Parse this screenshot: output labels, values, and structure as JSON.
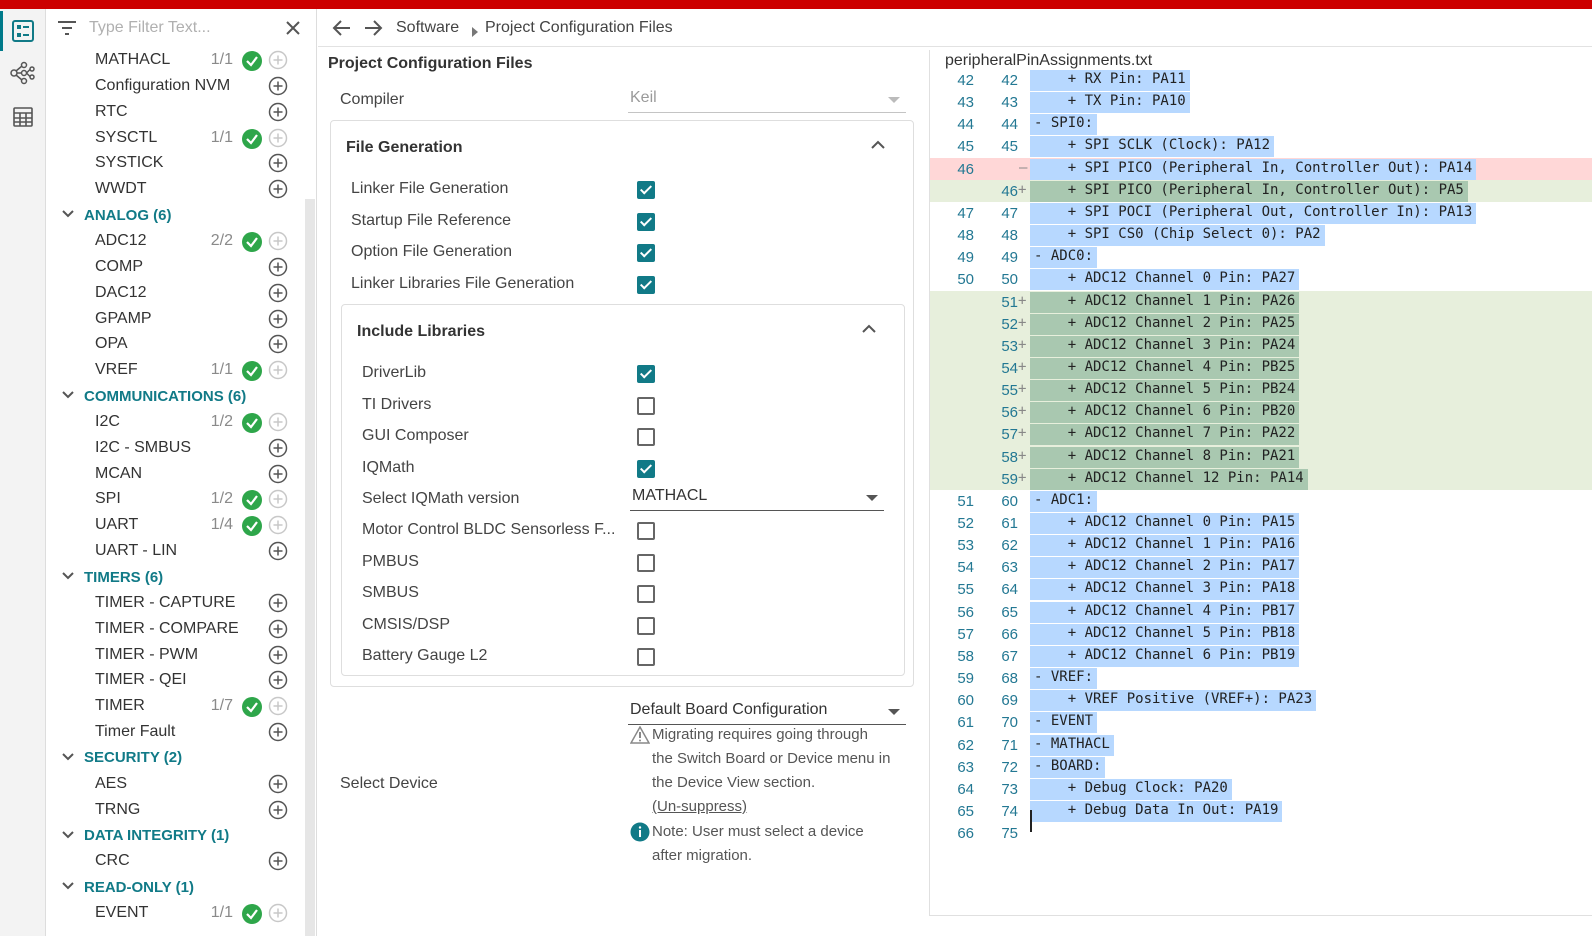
{
  "colors": {
    "accent": "#117a87",
    "topbar": "#cc0000",
    "selection": "#b7d8ff",
    "ok": "#2ea64a"
  },
  "activity": [
    {
      "icon": "configuration-list-icon"
    },
    {
      "icon": "hierarchy-diagram-icon"
    },
    {
      "icon": "calculator-icon"
    }
  ],
  "filter": {
    "placeholder": "Type Filter Text..."
  },
  "tree": [
    {
      "kind": "item",
      "label": "MATHACL",
      "count": "1/1",
      "ok": true
    },
    {
      "kind": "item",
      "label": "Configuration NVM",
      "count": "",
      "ok": false
    },
    {
      "kind": "item",
      "label": "RTC",
      "count": "",
      "ok": false
    },
    {
      "kind": "item",
      "label": "SYSCTL",
      "count": "1/1",
      "ok": true
    },
    {
      "kind": "item",
      "label": "SYSTICK",
      "count": "",
      "ok": false
    },
    {
      "kind": "item",
      "label": "WWDT",
      "count": "",
      "ok": false
    },
    {
      "kind": "cat",
      "label": "ANALOG (6)"
    },
    {
      "kind": "item",
      "label": "ADC12",
      "count": "2/2",
      "ok": true
    },
    {
      "kind": "item",
      "label": "COMP",
      "count": "",
      "ok": false
    },
    {
      "kind": "item",
      "label": "DAC12",
      "count": "",
      "ok": false
    },
    {
      "kind": "item",
      "label": "GPAMP",
      "count": "",
      "ok": false
    },
    {
      "kind": "item",
      "label": "OPA",
      "count": "",
      "ok": false
    },
    {
      "kind": "item",
      "label": "VREF",
      "count": "1/1",
      "ok": true
    },
    {
      "kind": "cat",
      "label": "COMMUNICATIONS (6)"
    },
    {
      "kind": "item",
      "label": "I2C",
      "count": "1/2",
      "ok": true
    },
    {
      "kind": "item",
      "label": "I2C - SMBUS",
      "count": "",
      "ok": false
    },
    {
      "kind": "item",
      "label": "MCAN",
      "count": "",
      "ok": false
    },
    {
      "kind": "item",
      "label": "SPI",
      "count": "1/2",
      "ok": true
    },
    {
      "kind": "item",
      "label": "UART",
      "count": "1/4",
      "ok": true
    },
    {
      "kind": "item",
      "label": "UART - LIN",
      "count": "",
      "ok": false
    },
    {
      "kind": "cat",
      "label": "TIMERS (6)"
    },
    {
      "kind": "item",
      "label": "TIMER - CAPTURE",
      "count": "",
      "ok": false
    },
    {
      "kind": "item",
      "label": "TIMER - COMPARE",
      "count": "",
      "ok": false
    },
    {
      "kind": "item",
      "label": "TIMER - PWM",
      "count": "",
      "ok": false
    },
    {
      "kind": "item",
      "label": "TIMER - QEI",
      "count": "",
      "ok": false
    },
    {
      "kind": "item",
      "label": "TIMER",
      "count": "1/7",
      "ok": true
    },
    {
      "kind": "item",
      "label": "Timer Fault",
      "count": "",
      "ok": false
    },
    {
      "kind": "cat",
      "label": "SECURITY (2)"
    },
    {
      "kind": "item",
      "label": "AES",
      "count": "",
      "ok": false
    },
    {
      "kind": "item",
      "label": "TRNG",
      "count": "",
      "ok": false
    },
    {
      "kind": "cat",
      "label": "DATA INTEGRITY (1)"
    },
    {
      "kind": "item",
      "label": "CRC",
      "count": "",
      "ok": false
    },
    {
      "kind": "cat",
      "label": "READ-ONLY (1)"
    },
    {
      "kind": "item",
      "label": "EVENT",
      "count": "1/1",
      "ok": true
    }
  ],
  "breadcrumb": {
    "root": "Software",
    "current": "Project Configuration Files"
  },
  "config": {
    "title": "Project Configuration Files",
    "compiler_label": "Compiler",
    "compiler_value": "Keil",
    "file_generation": {
      "title": "File Generation",
      "options": [
        {
          "label": "Linker File Generation",
          "checked": true
        },
        {
          "label": "Startup File Reference",
          "checked": true
        },
        {
          "label": "Option File Generation",
          "checked": true
        },
        {
          "label": "Linker Libraries File Generation",
          "checked": true
        }
      ]
    },
    "include_libraries": {
      "title": "Include Libraries",
      "options": [
        {
          "label": "DriverLib",
          "checked": true
        },
        {
          "label": "TI Drivers",
          "checked": false
        },
        {
          "label": "GUI Composer",
          "checked": false
        },
        {
          "label": "IQMath",
          "checked": true
        }
      ],
      "iqmath_label": "Select IQMath version",
      "iqmath_value": "MATHACL",
      "more_options": [
        {
          "label": "Motor Control BLDC Sensorless F...",
          "checked": false
        },
        {
          "label": "PMBUS",
          "checked": false
        },
        {
          "label": "SMBUS",
          "checked": false
        },
        {
          "label": "CMSIS/DSP",
          "checked": false
        },
        {
          "label": "Battery Gauge L2",
          "checked": false
        }
      ]
    },
    "select_device_label": "Select Device",
    "board_value": "Default Board Configuration",
    "warning_lines": [
      "Migrating requires going through",
      "the Switch Board or Device menu in",
      "the Device View section."
    ],
    "unsuppress": "(Un-suppress)",
    "info_lines": [
      "Note: User must select a device",
      "after migration."
    ]
  },
  "editor": {
    "filename": "peripheralPinAssignments.txt",
    "lines": [
      {
        "l": "42",
        "r": "42",
        "type": "same",
        "text": "    + RX Pin: PA11"
      },
      {
        "l": "43",
        "r": "43",
        "type": "same",
        "text": "    + TX Pin: PA10"
      },
      {
        "l": "44",
        "r": "44",
        "type": "same",
        "text": "- SPI0:"
      },
      {
        "l": "45",
        "r": "45",
        "type": "same",
        "text": "    + SPI SCLK (Clock): PA12"
      },
      {
        "l": "46",
        "r": "",
        "type": "del",
        "text": "    + SPI PICO (Peripheral In, Controller Out): PA14"
      },
      {
        "l": "",
        "r": "46",
        "type": "add",
        "text": "    + SPI PICO (Peripheral In, Controller Out): PA5"
      },
      {
        "l": "47",
        "r": "47",
        "type": "same",
        "text": "    + SPI POCI (Peripheral Out, Controller In): PA13"
      },
      {
        "l": "48",
        "r": "48",
        "type": "same",
        "text": "    + SPI CS0 (Chip Select 0): PA2"
      },
      {
        "l": "49",
        "r": "49",
        "type": "same",
        "text": "- ADC0:"
      },
      {
        "l": "50",
        "r": "50",
        "type": "same",
        "text": "    + ADC12 Channel 0 Pin: PA27"
      },
      {
        "l": "",
        "r": "51",
        "type": "add",
        "text": "    + ADC12 Channel 1 Pin: PA26"
      },
      {
        "l": "",
        "r": "52",
        "type": "add",
        "text": "    + ADC12 Channel 2 Pin: PA25"
      },
      {
        "l": "",
        "r": "53",
        "type": "add",
        "text": "    + ADC12 Channel 3 Pin: PA24"
      },
      {
        "l": "",
        "r": "54",
        "type": "add",
        "text": "    + ADC12 Channel 4 Pin: PB25"
      },
      {
        "l": "",
        "r": "55",
        "type": "add",
        "text": "    + ADC12 Channel 5 Pin: PB24"
      },
      {
        "l": "",
        "r": "56",
        "type": "add",
        "text": "    + ADC12 Channel 6 Pin: PB20"
      },
      {
        "l": "",
        "r": "57",
        "type": "add",
        "text": "    + ADC12 Channel 7 Pin: PA22"
      },
      {
        "l": "",
        "r": "58",
        "type": "add",
        "text": "    + ADC12 Channel 8 Pin: PA21"
      },
      {
        "l": "",
        "r": "59",
        "type": "add",
        "text": "    + ADC12 Channel 12 Pin: PA14"
      },
      {
        "l": "51",
        "r": "60",
        "type": "same",
        "text": "- ADC1:"
      },
      {
        "l": "52",
        "r": "61",
        "type": "same",
        "text": "    + ADC12 Channel 0 Pin: PA15"
      },
      {
        "l": "53",
        "r": "62",
        "type": "same",
        "text": "    + ADC12 Channel 1 Pin: PA16"
      },
      {
        "l": "54",
        "r": "63",
        "type": "same",
        "text": "    + ADC12 Channel 2 Pin: PA17"
      },
      {
        "l": "55",
        "r": "64",
        "type": "same",
        "text": "    + ADC12 Channel 3 Pin: PA18"
      },
      {
        "l": "56",
        "r": "65",
        "type": "same",
        "text": "    + ADC12 Channel 4 Pin: PB17"
      },
      {
        "l": "57",
        "r": "66",
        "type": "same",
        "text": "    + ADC12 Channel 5 Pin: PB18"
      },
      {
        "l": "58",
        "r": "67",
        "type": "same",
        "text": "    + ADC12 Channel 6 Pin: PB19"
      },
      {
        "l": "59",
        "r": "68",
        "type": "same",
        "text": "- VREF:"
      },
      {
        "l": "60",
        "r": "69",
        "type": "same",
        "text": "    + VREF Positive (VREF+): PA23"
      },
      {
        "l": "61",
        "r": "70",
        "type": "same",
        "text": "- EVENT"
      },
      {
        "l": "62",
        "r": "71",
        "type": "same",
        "text": "- MATHACL"
      },
      {
        "l": "63",
        "r": "72",
        "type": "same",
        "text": "- BOARD:"
      },
      {
        "l": "64",
        "r": "73",
        "type": "same",
        "text": "    + Debug Clock: PA20"
      },
      {
        "l": "65",
        "r": "74",
        "type": "same",
        "text": "    + Debug Data In Out: PA19"
      },
      {
        "l": "66",
        "r": "75",
        "type": "same",
        "text": ""
      }
    ]
  }
}
